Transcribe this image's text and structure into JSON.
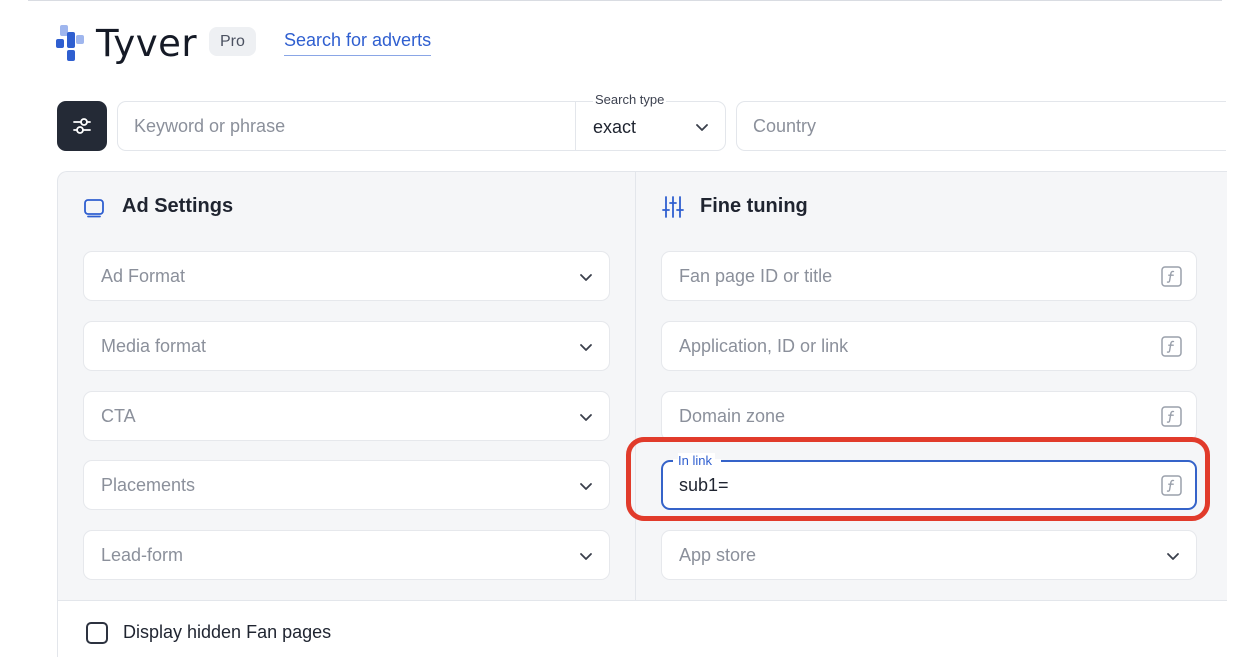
{
  "header": {
    "brand": "Tyver",
    "badge": "Pro",
    "nav_link": "Search for adverts"
  },
  "search": {
    "keyword_placeholder": "Keyword or phrase",
    "search_type_label": "Search type",
    "search_type_value": "exact",
    "country_placeholder": "Country"
  },
  "ad_settings": {
    "title": "Ad Settings",
    "fields": [
      "Ad Format",
      "Media format",
      "CTA",
      "Placements",
      "Lead-form"
    ]
  },
  "fine_tuning": {
    "title": "Fine tuning",
    "fan_page": "Fan page ID or title",
    "application": "Application, ID or link",
    "domain_zone": "Domain zone",
    "in_link_label": "In link",
    "in_link_value": "sub1=",
    "app_store": "App store"
  },
  "footer": {
    "hidden_fan_pages": "Display hidden Fan pages"
  },
  "colors": {
    "accent": "#2f5fd0",
    "highlight": "#e13b2b",
    "dark_button": "#242a36"
  }
}
